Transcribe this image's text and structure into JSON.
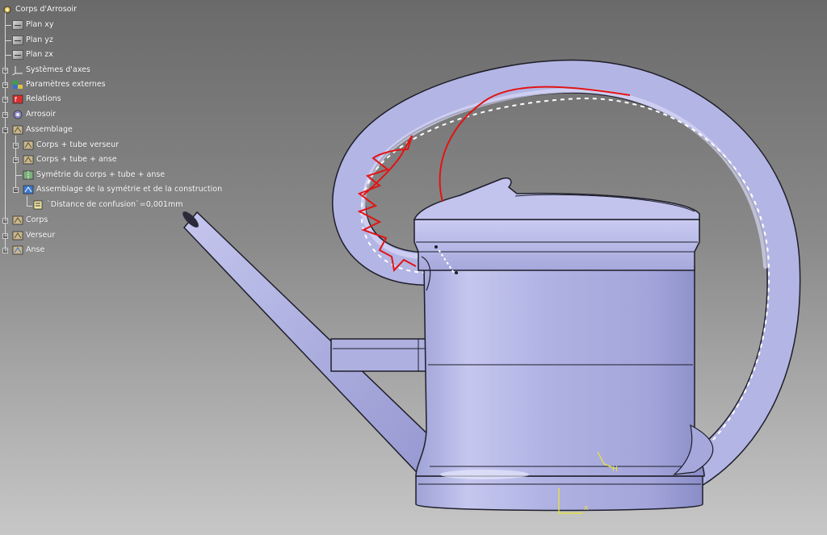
{
  "tree": {
    "root": "Corps d'Arrosoir",
    "items": [
      {
        "label": "Plan xy",
        "icon": "plane-icon"
      },
      {
        "label": "Plan yz",
        "icon": "plane-icon"
      },
      {
        "label": "Plan zx",
        "icon": "plane-icon"
      },
      {
        "label": "Systèmes d'axes",
        "icon": "axis-system-icon"
      },
      {
        "label": "Paramètres externes",
        "icon": "parameters-icon"
      },
      {
        "label": "Relations",
        "icon": "relations-icon"
      },
      {
        "label": "Arrosoir",
        "icon": "body-icon"
      },
      {
        "label": "Assemblage",
        "icon": "assembly-icon"
      },
      {
        "label": "Corps + tube verseur",
        "icon": "assembly-icon"
      },
      {
        "label": "Corps + tube + anse",
        "icon": "assembly-icon"
      },
      {
        "label": "Symétrie du corps + tube + anse",
        "icon": "symmetry-icon"
      },
      {
        "label": "Assemblage de la symétrie et de la construction",
        "icon": "assembly-icon"
      },
      {
        "label": "`Distance de confusion`=0,001mm",
        "icon": "parameter-icon"
      },
      {
        "label": "Corps",
        "icon": "assembly-icon"
      },
      {
        "label": "Verseur",
        "icon": "assembly-icon"
      },
      {
        "label": "Anse",
        "icon": "assembly-icon"
      }
    ]
  },
  "viewer": {
    "model_name": "watering-can",
    "colors": {
      "body": "#b7b9e4",
      "outline": "#1e1e2a",
      "guide_curve": "#e11414",
      "dashed": "#ffffff",
      "axis": "#e8e43a",
      "background_top": "#6a6a6a",
      "background_bottom": "#c7c7c7"
    }
  }
}
